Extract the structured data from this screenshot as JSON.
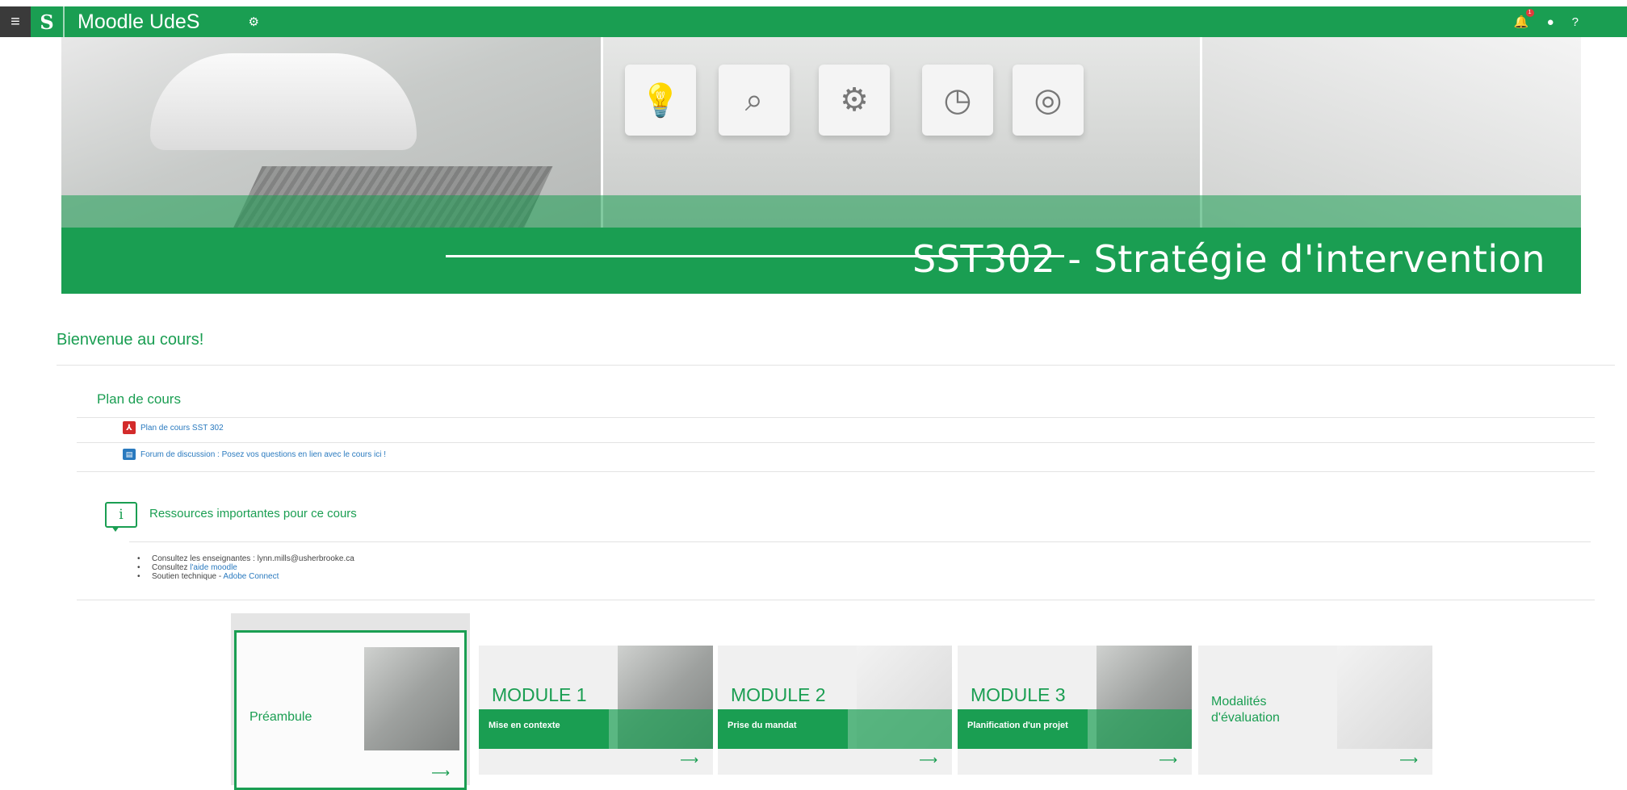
{
  "topbar": {
    "menu_icon": "hamburger-icon",
    "logo_letter": "S",
    "brand": "Moodle UdeS",
    "icons": [
      "cogs-icon",
      "bell-icon",
      "chat-icon",
      "help-icon"
    ],
    "notification_count": "1"
  },
  "banner": {
    "course_title": "SST302 - Stratégie d'intervention",
    "cube_icons": [
      "lightbulb-icon",
      "search-icon",
      "gears-icon",
      "clock-icon",
      "target-icon"
    ]
  },
  "welcome": "Bienvenue au cours!",
  "plan": {
    "title": "Plan de cours",
    "items": [
      {
        "label": "Plan de cours SST 302",
        "icon": "pdf-icon"
      },
      {
        "label": "Forum de discussion : Posez vos questions en lien avec le cours ici !",
        "icon": "forum-icon"
      }
    ]
  },
  "resources": {
    "title": "Ressources importantes pour ce cours",
    "bullets": [
      {
        "prefix": "Consultez les enseignantes : lynn.mills@usherbrooke.ca",
        "link": ""
      },
      {
        "prefix": "Consultez ",
        "link": "l'aide moodle"
      },
      {
        "prefix": "Soutien technique - ",
        "link": "Adobe Connect"
      }
    ]
  },
  "tiles": [
    {
      "title": "Préambule",
      "subtitle": "",
      "arrow": "⟶"
    },
    {
      "title": "MODULE 1",
      "subtitle": "Mise en contexte",
      "arrow": "⟶"
    },
    {
      "title": "MODULE 2",
      "subtitle": "Prise du mandat",
      "arrow": "⟶"
    },
    {
      "title": "MODULE 3",
      "subtitle": "Planification d'un projet",
      "arrow": "⟶"
    },
    {
      "title": "Modalités d'évaluation",
      "subtitle": "",
      "arrow": "⟶"
    }
  ],
  "colors": {
    "brand_green": "#1a9e52",
    "link_blue": "#2a7abf"
  }
}
